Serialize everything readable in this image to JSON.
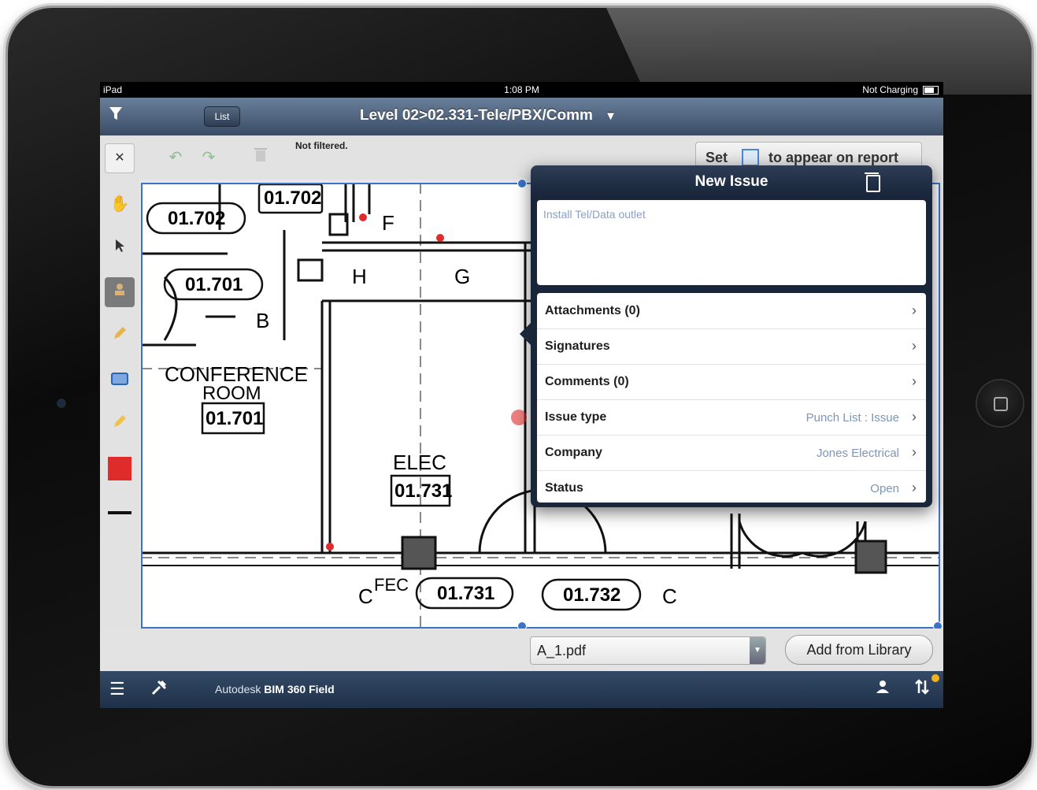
{
  "device": {
    "status_left": "iPad",
    "status_time": "1:08 PM",
    "status_right": "Not Charging"
  },
  "navbar": {
    "list_label": "List",
    "title": "Level 02>02.331-Tele/PBX/Comm",
    "title_arrow": "▼"
  },
  "toolbar": {
    "filter_status": "Not filtered.",
    "set_label": "Set",
    "report_label": "to appear on report"
  },
  "drawing": {
    "room_tags": [
      "01.702",
      "01.702",
      "01.701",
      "01.731",
      "01.732"
    ],
    "room_names": [
      "CONFERENCE",
      "ROOM",
      "ELEC"
    ],
    "room_numbers": [
      "01.701",
      "01.731"
    ],
    "keynotes": [
      "F",
      "G",
      "H",
      "B",
      "C",
      "C"
    ],
    "fec_label": "FEC"
  },
  "popover": {
    "title": "New Issue",
    "description": "Install Tel/Data outlet",
    "rows": [
      {
        "label": "Attachments (0)",
        "value": ""
      },
      {
        "label": "Signatures",
        "value": ""
      },
      {
        "label": "Comments (0)",
        "value": ""
      },
      {
        "label": "Issue type",
        "value": "Punch List : Issue"
      },
      {
        "label": "Company",
        "value": "Jones Electrical"
      },
      {
        "label": "Status",
        "value": "Open"
      }
    ]
  },
  "bottom": {
    "file_value": "A_1.pdf",
    "add_library_label": "Add from Library"
  },
  "footer": {
    "brand_prefix": "Autodesk",
    "brand_name": "BIM 360 Field"
  },
  "colors": {
    "accent": "#3a73c7",
    "markup_red": "#e02b2b",
    "value_blue": "#7e95b6"
  }
}
